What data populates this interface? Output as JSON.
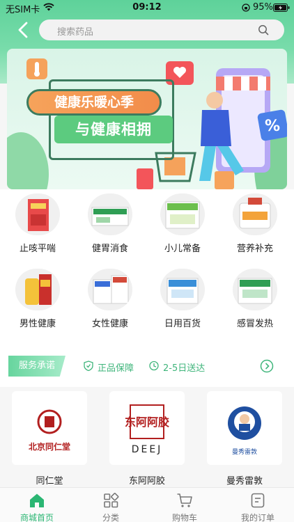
{
  "status_bar": {
    "carrier": "无SIM卡",
    "time": "09:12",
    "battery": "95%"
  },
  "search": {
    "placeholder": "搜索药品"
  },
  "banner": {
    "title_line1": "健康乐暖心季",
    "title_line2": "与健康相拥"
  },
  "categories": [
    {
      "label": "止咳平喘",
      "icon": "cough-medicine-box"
    },
    {
      "label": "健胃消食",
      "icon": "digestive-medicine-box"
    },
    {
      "label": "小儿常备",
      "icon": "child-medicine-box"
    },
    {
      "label": "营养补充",
      "icon": "supplement-bottle"
    },
    {
      "label": "男性健康",
      "icon": "mens-health-bottle"
    },
    {
      "label": "女性健康",
      "icon": "womens-health-box"
    },
    {
      "label": "日用百货",
      "icon": "daily-goods-box"
    },
    {
      "label": "感冒发热",
      "icon": "cold-fever-box"
    }
  ],
  "service": {
    "tag": "服务承诺",
    "items": [
      "正品保障",
      "2-5日送达"
    ]
  },
  "brands": [
    {
      "label": "同仁堂",
      "logo_text": "北京同仁堂"
    },
    {
      "label": "东阿阿胶",
      "logo_text": "东阿阿胶",
      "logo_sub": "DEEJ"
    },
    {
      "label": "曼秀雷敦",
      "logo_text": "曼秀雷敦"
    }
  ],
  "tabs": [
    {
      "label": "商城首页",
      "active": true
    },
    {
      "label": "分类",
      "active": false
    },
    {
      "label": "购物车",
      "active": false
    },
    {
      "label": "我的订单",
      "active": false
    }
  ],
  "colors": {
    "accent": "#2bb673",
    "header": "#5ed29a"
  }
}
